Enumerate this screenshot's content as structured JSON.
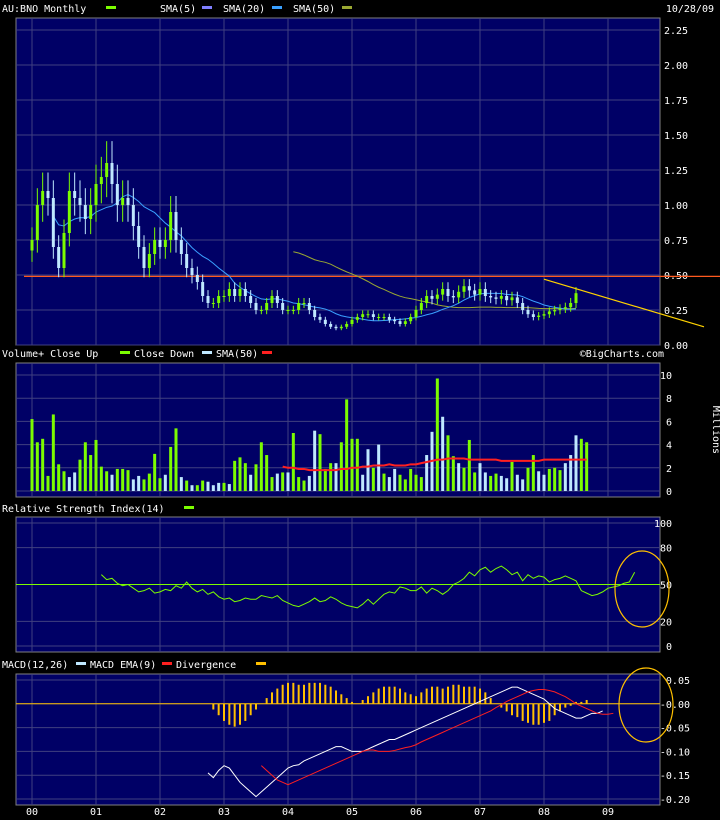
{
  "chart_data": [
    {
      "panel": "price",
      "type": "candlestick",
      "title": "AU:BNO Monthly",
      "date": "10/28/09",
      "legend": [
        {
          "name": "AU:BNO Monthly",
          "color": "#7CFC00"
        },
        {
          "name": "SMA(5)",
          "color": "#8080ff"
        },
        {
          "name": "SMA(20)",
          "color": "#3aa0ff"
        },
        {
          "name": "SMA(50)",
          "color": "#9aa832"
        }
      ],
      "ylim": [
        0.0,
        2.25
      ],
      "yticks": [
        "2.25",
        "2.00",
        "1.75",
        "1.50",
        "1.25",
        "1.00",
        "0.75",
        "0.50",
        "0.25",
        "0.00"
      ],
      "xticks": [
        "00",
        "01",
        "02",
        "03",
        "04",
        "05",
        "06",
        "07",
        "08",
        "09"
      ],
      "xlim": [
        0,
        10.6
      ],
      "hline": {
        "y": 0.49,
        "color": "#ff5a1e"
      },
      "trendline": {
        "x": [
          8.0,
          10.5
        ],
        "y": [
          0.47,
          0.13
        ],
        "color": "#ffd200"
      },
      "close": [
        0.75,
        1.0,
        1.1,
        1.05,
        0.7,
        0.55,
        0.8,
        1.1,
        1.05,
        1.0,
        0.9,
        1.0,
        1.15,
        1.2,
        1.3,
        1.15,
        1.0,
        1.05,
        1.0,
        0.85,
        0.7,
        0.55,
        0.65,
        0.75,
        0.7,
        0.75,
        0.95,
        0.75,
        0.65,
        0.55,
        0.5,
        0.45,
        0.35,
        0.3,
        0.3,
        0.35,
        0.35,
        0.4,
        0.35,
        0.4,
        0.35,
        0.3,
        0.25,
        0.25,
        0.3,
        0.35,
        0.3,
        0.25,
        0.25,
        0.25,
        0.3,
        0.3,
        0.25,
        0.2,
        0.18,
        0.15,
        0.13,
        0.12,
        0.13,
        0.15,
        0.18,
        0.2,
        0.22,
        0.22,
        0.2,
        0.2,
        0.2,
        0.18,
        0.17,
        0.15,
        0.17,
        0.2,
        0.25,
        0.3,
        0.35,
        0.33,
        0.36,
        0.4,
        0.35,
        0.34,
        0.38,
        0.42,
        0.39,
        0.36,
        0.4,
        0.35,
        0.34,
        0.33,
        0.35,
        0.32,
        0.34,
        0.3,
        0.25,
        0.22,
        0.2,
        0.21,
        0.22,
        0.24,
        0.25,
        0.26,
        0.27,
        0.3,
        0.37
      ]
    },
    {
      "panel": "volume",
      "type": "bar",
      "legend": [
        {
          "name": "Volume+ Close Up",
          "color": "#7CFC00"
        },
        {
          "name": "Close Down",
          "color": "#bfe8ff"
        },
        {
          "name": "SMA(50)",
          "color": "#ff2020"
        }
      ],
      "ylabel": "Millions",
      "ylim": [
        0,
        10
      ],
      "yticks": [
        "10",
        "8",
        "6",
        "4",
        "2",
        "0"
      ],
      "values": [
        6.2,
        4.2,
        4.5,
        1.3,
        6.6,
        2.3,
        1.7,
        1.2,
        1.6,
        2.7,
        4.2,
        3.1,
        4.4,
        2.1,
        1.7,
        1.4,
        1.9,
        1.9,
        1.8,
        1.0,
        1.3,
        1.0,
        1.5,
        3.2,
        1.1,
        1.4,
        3.8,
        5.4,
        1.2,
        0.9,
        0.5,
        0.5,
        0.9,
        0.8,
        0.5,
        0.7,
        0.7,
        0.6,
        2.6,
        2.9,
        2.4,
        1.4,
        2.3,
        4.2,
        3.1,
        1.2,
        1.5,
        1.6,
        1.6,
        5.0,
        1.2,
        0.9,
        1.3,
        5.2,
        4.9,
        1.9,
        2.4,
        2.4,
        4.2,
        7.9,
        4.5,
        4.5,
        1.4,
        3.6,
        2.0,
        4.0,
        1.5,
        1.2,
        1.9,
        1.4,
        1.0,
        1.9,
        1.4,
        1.2,
        3.1,
        5.1,
        9.7,
        6.4,
        4.8,
        3.0,
        2.4,
        2.0,
        4.4,
        1.6,
        2.4,
        1.6,
        1.3,
        1.5,
        1.3,
        1.1,
        2.5,
        1.4,
        1.0,
        2.0,
        3.1,
        1.7,
        1.4,
        1.9,
        2.0,
        1.8,
        2.4,
        3.1,
        4.8,
        4.5,
        4.2
      ],
      "up": [
        1,
        1,
        1,
        1,
        1,
        1,
        1,
        0,
        0,
        1,
        1,
        1,
        1,
        1,
        1,
        0,
        1,
        1,
        1,
        0,
        0,
        1,
        1,
        1,
        1,
        0,
        1,
        1,
        0,
        1,
        0,
        1,
        1,
        0,
        0,
        0,
        1,
        0,
        1,
        1,
        1,
        0,
        1,
        1,
        1,
        1,
        0,
        1,
        0,
        1,
        1,
        1,
        0,
        0,
        1,
        1,
        1,
        0,
        1,
        1,
        1,
        1,
        0,
        0,
        1,
        0,
        1,
        0,
        0,
        1,
        1,
        1,
        1,
        1,
        0,
        0,
        1,
        0,
        1,
        1,
        0,
        1,
        1,
        1,
        0,
        0,
        1,
        1,
        0,
        0,
        1,
        0,
        0,
        1,
        1,
        0,
        0,
        1,
        1,
        1,
        0,
        0,
        0,
        1,
        1
      ],
      "sma": {
        "start": 47,
        "values": [
          2.1,
          2.0,
          2.0,
          1.9,
          1.9,
          1.8,
          1.8,
          1.8,
          1.8,
          1.8,
          1.8,
          1.9,
          1.9,
          2.0,
          2.0,
          2.1,
          2.1,
          2.2,
          2.2,
          2.2,
          2.3,
          2.2,
          2.2,
          2.2,
          2.3,
          2.3,
          2.4,
          2.5,
          2.6,
          2.7,
          2.7,
          2.8,
          2.8,
          2.8,
          2.8,
          2.7,
          2.7,
          2.7,
          2.7,
          2.7,
          2.7,
          2.6,
          2.6,
          2.6,
          2.6,
          2.6,
          2.6,
          2.6,
          2.6,
          2.7,
          2.7,
          2.7,
          2.7,
          2.7,
          2.7,
          2.7,
          2.7,
          2.7
        ]
      }
    },
    {
      "panel": "rsi",
      "type": "line",
      "legend": [
        {
          "name": "Relative Strength Index(14)",
          "color": "#7CFC00"
        }
      ],
      "ylim": [
        0,
        100
      ],
      "yticks": [
        "100",
        "80",
        "50",
        "20",
        "0"
      ],
      "hline": 50,
      "start": 13,
      "values": [
        58,
        54,
        55,
        51,
        49,
        50,
        47,
        44,
        45,
        47,
        43,
        44,
        46,
        45,
        49,
        47,
        52,
        47,
        44,
        46,
        42,
        44,
        40,
        38,
        39,
        36,
        37,
        39,
        38,
        38,
        41,
        40,
        39,
        41,
        37,
        35,
        33,
        32,
        34,
        36,
        39,
        36,
        37,
        40,
        38,
        35,
        33,
        32,
        31,
        34,
        38,
        34,
        38,
        42,
        44,
        43,
        48,
        47,
        45,
        45,
        48,
        43,
        47,
        45,
        42,
        45,
        50,
        52,
        55,
        60,
        57,
        62,
        64,
        60,
        63,
        65,
        62,
        58,
        60,
        53,
        58,
        55,
        57,
        56,
        52,
        54,
        55,
        57,
        55,
        53,
        45,
        43,
        41,
        42,
        44,
        47,
        48,
        49,
        51,
        52,
        60
      ]
    },
    {
      "panel": "macd",
      "type": "line",
      "legend": [
        {
          "name": "MACD(12,26)",
          "color": "#bfe8ff"
        },
        {
          "name": "MACD EMA(9)",
          "color": "#ff2020"
        },
        {
          "name": "Divergence",
          "color": "#ffc000"
        }
      ],
      "ylim": [
        -0.2,
        0.05
      ],
      "yticks": [
        "0.05",
        "-0.00",
        "-0.05",
        "-0.10",
        "-0.15",
        "-0.20"
      ],
      "macd": {
        "start": 33,
        "values": [
          -0.145,
          -0.155,
          -0.14,
          -0.13,
          -0.135,
          -0.15,
          -0.165,
          -0.175,
          -0.185,
          -0.195,
          -0.185,
          -0.175,
          -0.165,
          -0.155,
          -0.145,
          -0.135,
          -0.13,
          -0.128,
          -0.12,
          -0.115,
          -0.11,
          -0.105,
          -0.1,
          -0.095,
          -0.09,
          -0.09,
          -0.095,
          -0.1,
          -0.1,
          -0.1,
          -0.095,
          -0.09,
          -0.085,
          -0.08,
          -0.075,
          -0.075,
          -0.07,
          -0.065,
          -0.06,
          -0.055,
          -0.05,
          -0.045,
          -0.04,
          -0.035,
          -0.03,
          -0.025,
          -0.02,
          -0.015,
          -0.01,
          -0.005,
          0.0,
          0.005,
          0.01,
          0.015,
          0.02,
          0.025,
          0.03,
          0.035,
          0.035,
          0.03,
          0.025,
          0.02,
          0.015,
          0.01,
          0.0,
          -0.01,
          -0.015,
          -0.02,
          -0.025,
          -0.03,
          -0.03,
          -0.025,
          -0.02,
          -0.02,
          -0.015
        ]
      },
      "signal": {
        "start": 43,
        "values": [
          -0.13,
          -0.14,
          -0.15,
          -0.16,
          -0.165,
          -0.17,
          -0.165,
          -0.16,
          -0.155,
          -0.15,
          -0.145,
          -0.14,
          -0.135,
          -0.13,
          -0.125,
          -0.12,
          -0.115,
          -0.11,
          -0.105,
          -0.1,
          -0.097,
          -0.097,
          -0.1,
          -0.1,
          -0.1,
          -0.098,
          -0.095,
          -0.092,
          -0.09,
          -0.086,
          -0.08,
          -0.075,
          -0.07,
          -0.065,
          -0.06,
          -0.055,
          -0.05,
          -0.045,
          -0.04,
          -0.035,
          -0.03,
          -0.025,
          -0.02,
          -0.015,
          -0.008,
          -0.002,
          0.005,
          0.01,
          0.015,
          0.02,
          0.025,
          0.028,
          0.03,
          0.03,
          0.028,
          0.025,
          0.02,
          0.015,
          0.008,
          0.0,
          -0.005,
          -0.01,
          -0.015,
          -0.02,
          -0.022,
          -0.022,
          -0.02
        ]
      },
      "divergence": [
        0,
        0,
        0,
        0,
        0,
        0,
        0,
        0,
        0,
        0,
        0,
        0,
        0,
        0,
        0,
        0,
        0,
        0,
        0,
        0,
        0,
        0,
        0,
        0,
        0,
        0,
        0,
        0,
        0,
        0,
        0,
        0,
        0,
        0,
        -0.003,
        -0.006,
        -0.009,
        -0.011,
        -0.012,
        -0.011,
        -0.009,
        -0.006,
        -0.003,
        0,
        0.003,
        0.006,
        0.008,
        0.01,
        0.011,
        0.011,
        0.01,
        0.01,
        0.011,
        0.011,
        0.011,
        0.01,
        0.009,
        0.007,
        0.005,
        0.003,
        0.001,
        0,
        0.002,
        0.004,
        0.006,
        0.008,
        0.009,
        0.009,
        0.009,
        0.008,
        0.006,
        0.005,
        0.004,
        0.006,
        0.008,
        0.009,
        0.009,
        0.008,
        0.009,
        0.01,
        0.01,
        0.009,
        0.009,
        0.009,
        0.008,
        0.006,
        0.003,
        0,
        -0.002,
        -0.004,
        -0.006,
        -0.007,
        -0.009,
        -0.01,
        -0.011,
        -0.011,
        -0.01,
        -0.009,
        -0.006,
        -0.004,
        -0.002,
        -0.001,
        0.001,
        0.001,
        0.002
      ]
    }
  ],
  "watermark": "©BigCharts.com",
  "annotation_color": "#ffc000"
}
